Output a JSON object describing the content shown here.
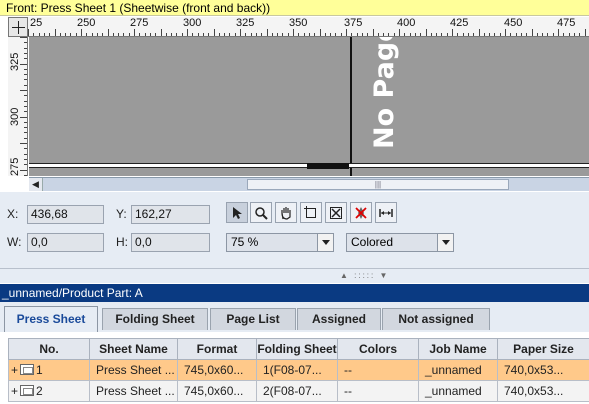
{
  "window": {
    "title": "Front:  Press Sheet 1 (Sheetwise (front and back))"
  },
  "ruler": {
    "h_labels": [
      "25",
      "250",
      "275",
      "300",
      "325",
      "350",
      "375",
      "400",
      "425",
      "450",
      "475"
    ],
    "v_labels": [
      "325",
      "300",
      "275"
    ]
  },
  "canvas": {
    "no_page_text": "No Page"
  },
  "coords": {
    "x_label": "X:",
    "x_value": "436,68",
    "y_label": "Y:",
    "y_value": "162,27",
    "w_label": "W:",
    "w_value": "0,0",
    "h_label": "H:",
    "h_value": "0,0"
  },
  "tools": [
    {
      "name": "pointer-tool-icon",
      "active": true
    },
    {
      "name": "zoom-tool-icon",
      "active": false
    },
    {
      "name": "hand-tool-icon",
      "active": false
    },
    {
      "name": "frame-tool-icon",
      "active": false
    },
    {
      "name": "crop-tool-icon",
      "active": false
    },
    {
      "name": "mark-tool-icon",
      "active": false
    },
    {
      "name": "measure-tool-icon",
      "active": false
    }
  ],
  "zoom": {
    "value": "75 %"
  },
  "color_mode": {
    "value": "Colored"
  },
  "part": {
    "title": "_unnamed/Product Part: A"
  },
  "tabs": [
    {
      "label": "Press Sheet",
      "active": true
    },
    {
      "label": "Folding Sheet",
      "active": false
    },
    {
      "label": "Page List",
      "active": false
    },
    {
      "label": "Assigned",
      "active": false
    },
    {
      "label": "Not assigned",
      "active": false
    }
  ],
  "table": {
    "headers": [
      "No.",
      "Sheet Name",
      "Format",
      "Folding Sheet",
      "Colors",
      "Job Name",
      "Paper Size"
    ],
    "rows": [
      {
        "expand": "+",
        "no": "1",
        "sheet_name": "Press Sheet ...",
        "format": "745,0x60...",
        "folding_sheet": "1(F08-07...",
        "colors": "--",
        "job_name": "_unnamed",
        "paper_size": "740,0x53...",
        "selected": true
      },
      {
        "expand": "+",
        "no": "2",
        "sheet_name": "Press Sheet ...",
        "format": "745,0x60...",
        "folding_sheet": "2(F08-07...",
        "colors": "--",
        "job_name": "_unnamed",
        "paper_size": "740,0x53...",
        "selected": false
      }
    ]
  },
  "colors": {
    "title_bg": "#ffff99",
    "part_bar": "#0a3a82",
    "selected_row": "#ffc98a",
    "canvas": "#9a9a9a"
  }
}
